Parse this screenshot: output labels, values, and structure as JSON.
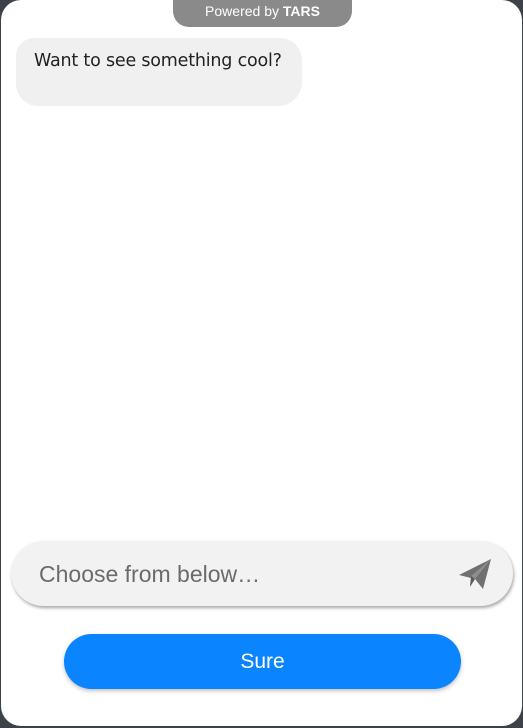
{
  "powered_by": {
    "prefix": "Powered by ",
    "brand": "TARS"
  },
  "messages": [
    {
      "sender": "bot",
      "text": "Want to see something cool?"
    }
  ],
  "input": {
    "placeholder": "Choose from below…"
  },
  "send": {
    "icon": "paper-plane-icon"
  },
  "quick_replies": [
    {
      "label": "Sure"
    }
  ],
  "colors": {
    "accent": "#0a84ff",
    "bubble_bg": "#f0f0f0",
    "pill_bg": "#8a8a8a",
    "icon": "#707070"
  }
}
